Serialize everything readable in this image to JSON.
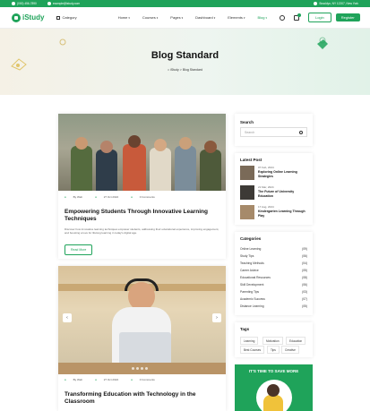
{
  "topbar": {
    "phone": "(000) 456-7890",
    "email": "example@istudy.com",
    "address": "Brooklyn, NY 12207, New York"
  },
  "nav": {
    "logo": "iStudy",
    "category": "Category",
    "menu": [
      "Home",
      "Courses",
      "Pages",
      "Dashboard",
      "Elements",
      "Blog"
    ],
    "active": "Blog",
    "login": "Login",
    "register": "Register"
  },
  "hero": {
    "title": "Blog Standard",
    "crumb_home": "iStudy",
    "crumb_sep": ">",
    "crumb_current": "Blog Standard"
  },
  "posts": [
    {
      "author": "By Web",
      "date": "27 Oct 2022",
      "comments": "0 Comments",
      "title": "Empowering Students Through Innovative Learning Techniques",
      "excerpt": "Discover how innovative learning techniques empower students, addressing their educational experience, improving engagement, and boosting a love for lifelong learning in today's digital age.",
      "button": "Read More"
    },
    {
      "author": "By Web",
      "date": "27 Oct 2022",
      "comments": "0 Comments",
      "title": "Transforming Education with Technology in the Classroom"
    }
  ],
  "sidebar": {
    "search_title": "Search",
    "search_placeholder": "Search",
    "latest_title": "Latest Post",
    "latest": [
      {
        "date": "07 Feb, 2024",
        "title": "Exploring Online Learning Strategies"
      },
      {
        "date": "21 Mar, 2024",
        "title": "The Future of University Education"
      },
      {
        "date": "17 Aug, 2024",
        "title": "Kindergarten Learning Through Play"
      }
    ],
    "categories_title": "Categories",
    "categories": [
      {
        "name": "Online Learning",
        "count": "(09)"
      },
      {
        "name": "Study Tips",
        "count": "(06)"
      },
      {
        "name": "Teaching Methods",
        "count": "(04)"
      },
      {
        "name": "Career Advice",
        "count": "(05)"
      },
      {
        "name": "Educational Resources",
        "count": "(08)"
      },
      {
        "name": "Skill Development",
        "count": "(06)"
      },
      {
        "name": "Parenting Tips",
        "count": "(03)"
      },
      {
        "name": "Academic Success",
        "count": "(07)"
      },
      {
        "name": "Distance Learning",
        "count": "(05)"
      }
    ],
    "tags_title": "Tags",
    "tags": [
      "Learning",
      "Motivation",
      "Education",
      "Best Courses",
      "Tips",
      "Creative"
    ],
    "promo": "IT'S TIME TO SAVE MORE"
  }
}
